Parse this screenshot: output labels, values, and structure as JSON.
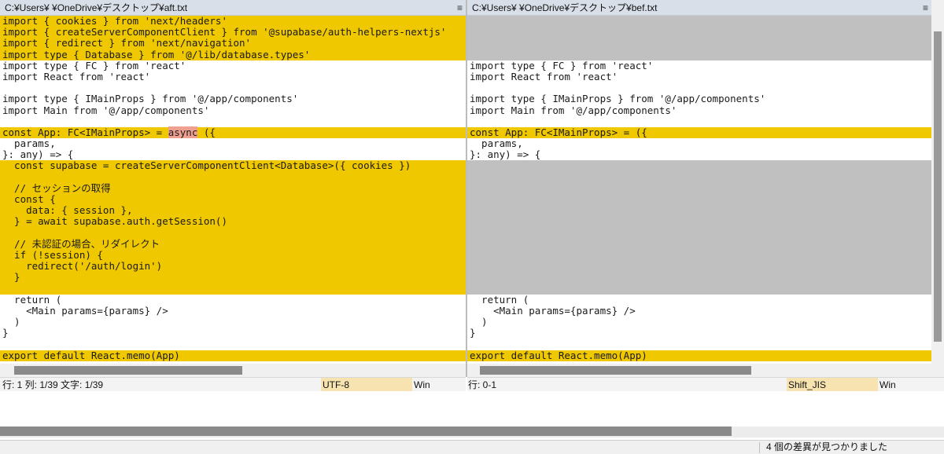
{
  "left": {
    "title": "C:¥Users¥          ¥OneDrive¥デスクトップ¥aft.txt",
    "lines": [
      {
        "text": "import { cookies } from 'next/headers'",
        "state": "changed"
      },
      {
        "text": "import { createServerComponentClient } from '@supabase/auth-helpers-nextjs'",
        "state": "changed"
      },
      {
        "text": "import { redirect } from 'next/navigation'",
        "state": "changed"
      },
      {
        "text": "import type { Database } from '@/lib/database.types'",
        "state": "changed"
      },
      {
        "text": "import type { FC } from 'react'",
        "state": "normal"
      },
      {
        "text": "import React from 'react'",
        "state": "normal"
      },
      {
        "text": "",
        "state": "normal"
      },
      {
        "text": "import type { IMainProps } from '@/app/components'",
        "state": "normal"
      },
      {
        "text": "import Main from '@/app/components'",
        "state": "normal"
      },
      {
        "text": "",
        "state": "normal"
      },
      {
        "text": "const App: FC<IMainProps> = ",
        "state": "changed",
        "highlight": "async",
        "after": " ({"
      },
      {
        "text": "  params,",
        "state": "normal"
      },
      {
        "text": "}: any) => {",
        "state": "normal"
      },
      {
        "text": "  const supabase = createServerComponentClient<Database>({ cookies })",
        "state": "changed"
      },
      {
        "text": "",
        "state": "changed"
      },
      {
        "text": "  // セッションの取得",
        "state": "changed"
      },
      {
        "text": "  const {",
        "state": "changed"
      },
      {
        "text": "    data: { session },",
        "state": "changed"
      },
      {
        "text": "  } = await supabase.auth.getSession()",
        "state": "changed"
      },
      {
        "text": "",
        "state": "changed"
      },
      {
        "text": "  // 未認証の場合、リダイレクト",
        "state": "changed"
      },
      {
        "text": "  if (!session) {",
        "state": "changed"
      },
      {
        "text": "    redirect('/auth/login')",
        "state": "changed"
      },
      {
        "text": "  }",
        "state": "changed"
      },
      {
        "text": "",
        "state": "changed"
      },
      {
        "text": "  return (",
        "state": "normal"
      },
      {
        "text": "    <Main params={params} />",
        "state": "normal"
      },
      {
        "text": "  )",
        "state": "normal"
      },
      {
        "text": "}",
        "state": "normal"
      },
      {
        "text": "",
        "state": "normal"
      },
      {
        "text": "export default React.memo(App)",
        "state": "changed"
      }
    ],
    "status": {
      "position": "行: 1  列: 1/39  文字: 1/39",
      "encoding": "UTF-8",
      "eol": "Win"
    }
  },
  "right": {
    "title": "C:¥Users¥          ¥OneDrive¥デスクトップ¥bef.txt",
    "lines": [
      {
        "text": "",
        "state": "gap"
      },
      {
        "text": "",
        "state": "gap"
      },
      {
        "text": "",
        "state": "gap"
      },
      {
        "text": "",
        "state": "gap"
      },
      {
        "text": "import type { FC } from 'react'",
        "state": "normal"
      },
      {
        "text": "import React from 'react'",
        "state": "normal"
      },
      {
        "text": "",
        "state": "normal"
      },
      {
        "text": "import type { IMainProps } from '@/app/components'",
        "state": "normal"
      },
      {
        "text": "import Main from '@/app/components'",
        "state": "normal"
      },
      {
        "text": "",
        "state": "normal"
      },
      {
        "text": "const App: FC<IMainProps> = ({",
        "state": "changed"
      },
      {
        "text": "  params,",
        "state": "normal"
      },
      {
        "text": "}: any) => {",
        "state": "normal"
      },
      {
        "text": "",
        "state": "gap"
      },
      {
        "text": "",
        "state": "gap"
      },
      {
        "text": "",
        "state": "gap"
      },
      {
        "text": "",
        "state": "gap"
      },
      {
        "text": "",
        "state": "gap"
      },
      {
        "text": "",
        "state": "gap"
      },
      {
        "text": "",
        "state": "gap"
      },
      {
        "text": "",
        "state": "gap"
      },
      {
        "text": "",
        "state": "gap"
      },
      {
        "text": "",
        "state": "gap"
      },
      {
        "text": "",
        "state": "gap"
      },
      {
        "text": "",
        "state": "gap"
      },
      {
        "text": "  return (",
        "state": "normal"
      },
      {
        "text": "    <Main params={params} />",
        "state": "normal"
      },
      {
        "text": "  )",
        "state": "normal"
      },
      {
        "text": "}",
        "state": "normal"
      },
      {
        "text": "",
        "state": "normal"
      },
      {
        "text": "export default React.memo(App)",
        "state": "changed"
      }
    ],
    "status": {
      "position": "行: 0-1",
      "encoding": "Shift_JIS",
      "eol": "Win"
    }
  },
  "footer": {
    "message": "4 個の差異が見つかりました"
  },
  "icons": {
    "pane_menu": "menu-icon"
  }
}
